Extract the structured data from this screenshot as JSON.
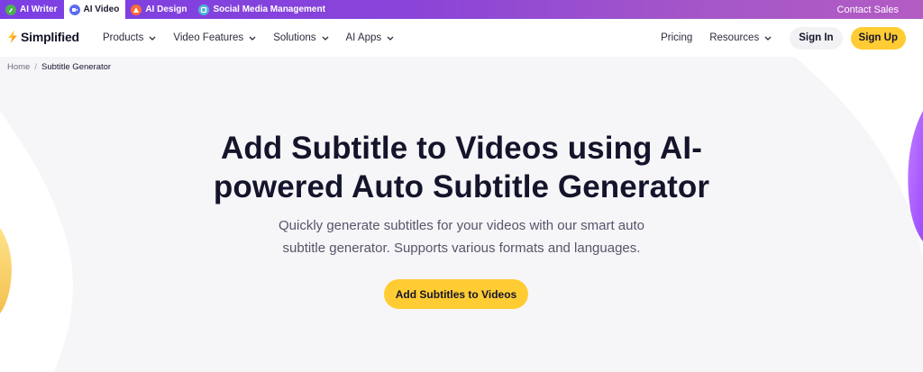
{
  "product_bar": {
    "tabs": [
      {
        "label": "AI Writer",
        "icon": "ai-writer-icon",
        "color": "#4caf50",
        "active": false
      },
      {
        "label": "AI Video",
        "icon": "ai-video-icon",
        "color": "#5b6cf0",
        "active": true
      },
      {
        "label": "AI Design",
        "icon": "ai-design-icon",
        "color": "#ff6b35",
        "active": false
      },
      {
        "label": "Social Media Management",
        "icon": "social-media-icon",
        "color": "#4fb3d9",
        "active": false
      }
    ],
    "contact": "Contact Sales"
  },
  "nav": {
    "logo_text": "Simplified",
    "items": [
      {
        "label": "Products"
      },
      {
        "label": "Video Features"
      },
      {
        "label": "Solutions"
      },
      {
        "label": "AI Apps"
      }
    ],
    "pricing": "Pricing",
    "resources": "Resources",
    "sign_in": "Sign In",
    "sign_up": "Sign Up"
  },
  "breadcrumb": {
    "home": "Home",
    "separator": "/",
    "current": "Subtitle Generator"
  },
  "hero": {
    "title_line1": "Add Subtitle to Videos using AI-",
    "title_line2": "powered Auto Subtitle Generator",
    "subtitle_line1": "Quickly generate subtitles for your videos with our smart auto",
    "subtitle_line2": "subtitle generator. Supports various formats and languages.",
    "cta": "Add Subtitles to Videos"
  },
  "colors": {
    "accent": "#ffcc33",
    "brand_purple": "#7b3fe4",
    "text_dark": "#14142b"
  }
}
